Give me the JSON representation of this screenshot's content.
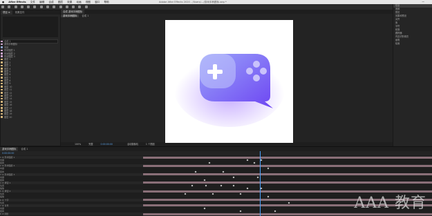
{
  "menubar": {
    "app": "After Effects",
    "items": [
      "文件",
      "编辑",
      "合成",
      "图层",
      "效果",
      "动画",
      "视图",
      "窗口",
      "帮助"
    ],
    "title": "Adobe After Effects 2020 - /Users/.../游戏手柄图标.aep *",
    "right": "一"
  },
  "project": {
    "tabs": [
      "项目 ≡",
      "效果控件"
    ],
    "rows": [
      {
        "name": "合成 1",
        "color": "#c9a3c9"
      },
      {
        "name": "游戏手柄图标",
        "color": "#c9a3c9"
      },
      {
        "name": "背景",
        "color": "#8aa0c9"
      },
      {
        "name": "形状图层 1",
        "color": "#c9a3c9"
      },
      {
        "name": "形状图层 2",
        "color": "#c9a3c9"
      },
      {
        "name": "形状图层 3",
        "color": "#c9a3c9"
      },
      {
        "name": "图层 1",
        "color": "#d1b27a"
      },
      {
        "name": "图层 2",
        "color": "#d1b27a"
      },
      {
        "name": "图层 3",
        "color": "#d1b27a"
      },
      {
        "name": "图层 4",
        "color": "#d1b27a"
      },
      {
        "name": "图层 5",
        "color": "#d1b27a"
      },
      {
        "name": "图层 6",
        "color": "#d1b27a"
      },
      {
        "name": "图层 7",
        "color": "#d1b27a"
      },
      {
        "name": "图层 8",
        "color": "#d1b27a"
      },
      {
        "name": "图层 9",
        "color": "#d1b27a"
      },
      {
        "name": "图层 10",
        "color": "#d1b27a"
      },
      {
        "name": "图层 11",
        "color": "#d1b27a"
      },
      {
        "name": "图层 12",
        "color": "#d1b27a"
      },
      {
        "name": "图层 13",
        "color": "#d1b27a"
      },
      {
        "name": "图层 14",
        "color": "#d1b27a"
      },
      {
        "name": "图层 15",
        "color": "#d1b27a"
      },
      {
        "name": "图层 16",
        "color": "#d1b27a"
      },
      {
        "name": "图层 17",
        "color": "#d1b27a"
      },
      {
        "name": "图层 18",
        "color": "#d1b27a"
      },
      {
        "name": "图层 19",
        "color": "#d1b27a"
      },
      {
        "name": "图层 20",
        "color": "#d1b27a"
      }
    ],
    "footer_tabs": [
      "游戏手柄图标",
      "合成 1"
    ]
  },
  "viewer": {
    "tab": "合成 游戏手柄图标",
    "subtabs": [
      "游戏手柄图标",
      "合成 1"
    ],
    "footer": [
      "100%",
      "完整",
      "0:00:00:00",
      "活动摄像机",
      "1 个视图"
    ]
  },
  "right_panel": {
    "items": [
      "信息",
      "音频",
      "预览",
      "效果和预设",
      "对齐",
      "库",
      "字符",
      "段落",
      "跟踪器",
      "内容识别填充",
      "画笔",
      "绘画"
    ]
  },
  "timeline": {
    "time": "0:00:00:00",
    "layers": [
      "1  ★ 形状图层 1",
      "    内容",
      "    变换",
      "2  ★ 形状图层 2",
      "    内容",
      "    变换",
      "3  ★ 形状图层 3",
      "    内容",
      "    变换",
      "4  ★ 按钮 1",
      "    位置",
      "    缩放",
      "5  ★ 按钮 2",
      "    位置",
      "    缩放",
      "6  ★ 十字",
      "    位置",
      "7  ★ 背景",
      "    内容",
      "    变换",
      "8  ★ 阴影"
    ]
  },
  "colors": {
    "icon_gradient_start": "#8b8cf7",
    "icon_gradient_end": "#6b3df0",
    "icon_shadow": "#a070ff",
    "canvas": "#ffffff",
    "timeline_bar": "#8a6f78"
  },
  "watermark": "AAA 教育"
}
